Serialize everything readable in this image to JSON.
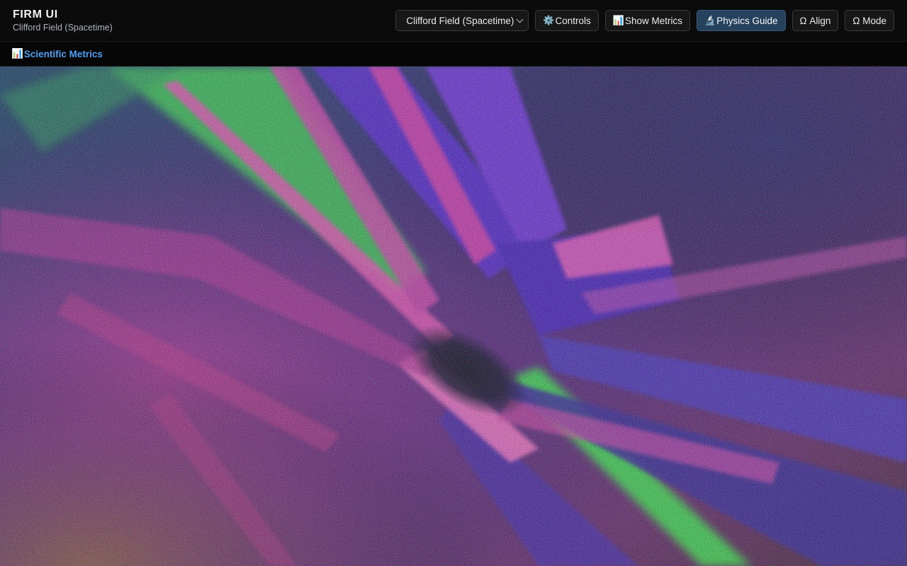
{
  "app": {
    "title": "FIRM UI",
    "subtitle": "Clifford Field (Spacetime)"
  },
  "toolbar": {
    "mode_select": {
      "value": "Clifford Field (Spacetime)",
      "options": [
        "Clifford Field (Spacetime)"
      ]
    },
    "controls_icon": "gear-icon",
    "controls_glyph": "⚙️",
    "controls_label": "Controls",
    "metrics_icon": "bar-chart-icon",
    "metrics_glyph": "📊",
    "show_metrics_label": "Show Metrics",
    "guide_icon": "microscope-icon",
    "guide_glyph": "🔬",
    "physics_guide_label": "Physics Guide",
    "align_label": "Ω Align",
    "mode_label": "Ω Mode"
  },
  "metrics_panel": {
    "icon": "bar-chart-icon",
    "glyph": "📊",
    "label": "Scientific Metrics"
  },
  "colors": {
    "active_button": "#26415c",
    "link": "#4d9ff2",
    "field_magenta": "#d1319b",
    "field_violet": "#4b1fc9",
    "field_green": "#2ee83a"
  }
}
